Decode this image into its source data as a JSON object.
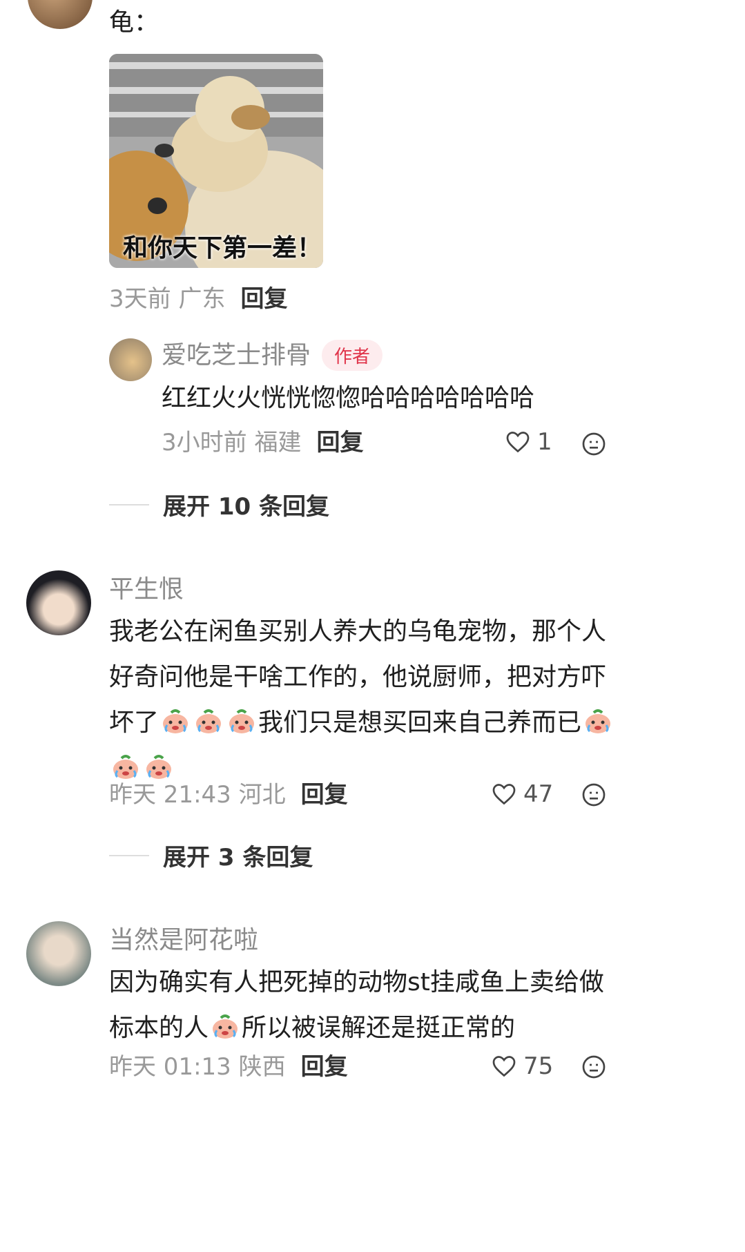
{
  "top_comment": {
    "text": "龟：",
    "image_caption": "和你天下第一差！",
    "meta": "3天前 广东",
    "reply_label": "回复"
  },
  "sub_reply": {
    "name": "爱吃芝士排骨",
    "badge": "作者",
    "text": "红红火火恍恍惚惚哈哈哈哈哈哈哈",
    "meta": "3小时前 福建",
    "reply_label": "回复",
    "likes": "1"
  },
  "expand_1": "展开 10 条回复",
  "comment_2": {
    "name": "平生恨",
    "line1": "我老公在闲鱼买别人养大的乌龟宠物，那个人",
    "line2": "好奇问他是干啥工作的，他说厨师，把对方吓",
    "line3a": "坏了",
    "line3b": "我们只是想买回来自己养而已",
    "meta": "昨天 21:43 河北",
    "reply_label": "回复",
    "likes": "47"
  },
  "expand_2": "展开 3 条回复",
  "comment_3": {
    "name": "当然是阿花啦",
    "line1": "因为确实有人把死掉的动物st挂咸鱼上卖给做",
    "line2a": "标本的人",
    "line2b": "所以被误解还是挺正常的",
    "meta": "昨天 01:13 陕西",
    "reply_label": "回复",
    "likes": "75"
  },
  "icons": [
    "heart-icon",
    "face-icon",
    "crying-emoji"
  ]
}
